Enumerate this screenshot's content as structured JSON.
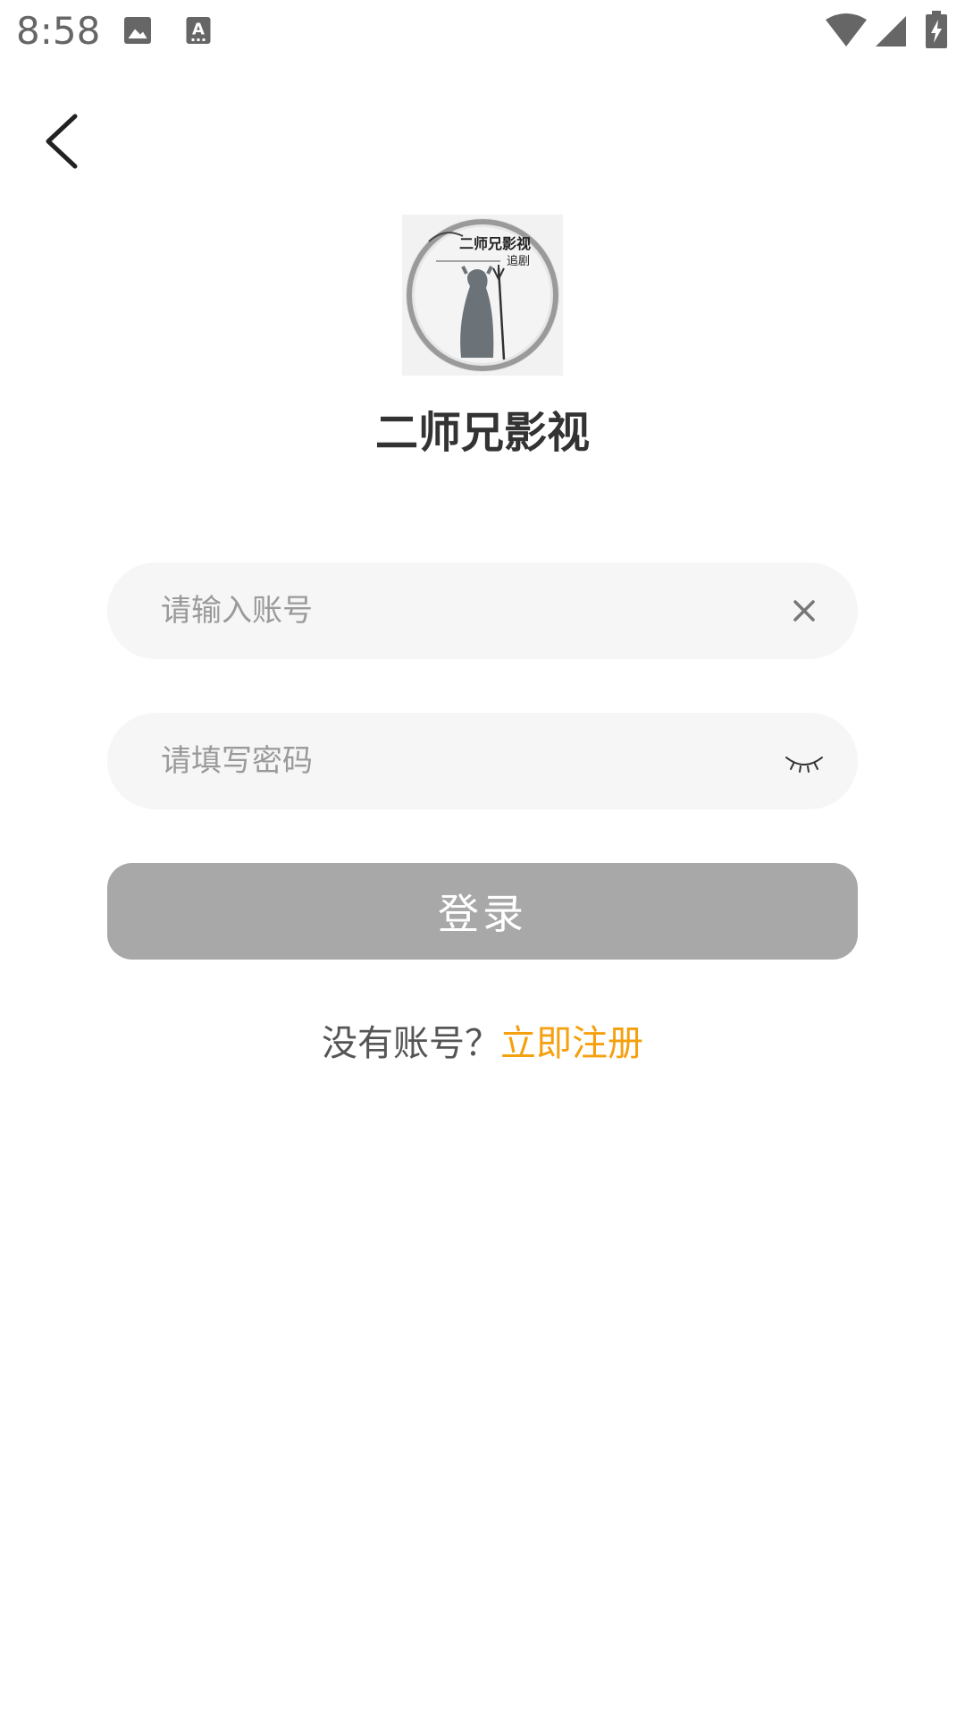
{
  "status_bar": {
    "time": "8:58",
    "icons": [
      "image-icon",
      "text-a-icon",
      "wifi-icon",
      "signal-icon",
      "battery-charging-icon"
    ]
  },
  "nav": {
    "back_icon": "chevron-left-icon"
  },
  "app": {
    "name": "二师兄影视",
    "logo_text_main": "二师兄影视",
    "logo_text_sub": "追剧"
  },
  "form": {
    "account_placeholder": "请输入账号",
    "account_value": "",
    "account_clear_icon": "close-icon",
    "password_placeholder": "请填写密码",
    "password_value": "",
    "password_toggle_icon": "eye-closed-icon",
    "login_label": "登录"
  },
  "register": {
    "prompt": "没有账号？",
    "link": "立即注册"
  },
  "colors": {
    "accent": "#f5a00f",
    "button_disabled": "#a8a8a8",
    "field_bg": "#f6f6f6"
  }
}
